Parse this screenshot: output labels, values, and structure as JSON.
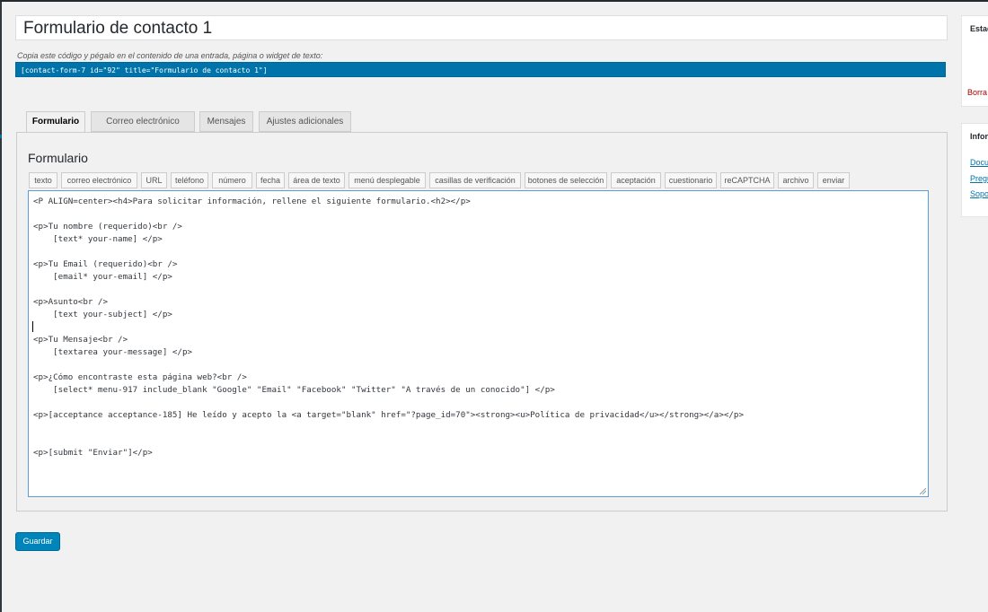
{
  "form": {
    "title": "Formulario de contacto 1",
    "shortcode_description": "Copia este código y pégalo en el contenido de una entrada, página o widget de texto:",
    "shortcode": "[contact-form-7 id=\"92\" title=\"Formulario de contacto 1\"]"
  },
  "tabs": [
    {
      "label": "Formulario",
      "active": true
    },
    {
      "label": "Correo electrónico",
      "active": false
    },
    {
      "label": "Mensajes",
      "active": false
    },
    {
      "label": "Ajustes adicionales",
      "active": false
    }
  ],
  "panel": {
    "title": "Formulario",
    "tag_buttons": [
      "texto",
      "correo electrónico",
      "URL",
      "teléfono",
      "número",
      "fecha",
      "área de texto",
      "menú desplegable",
      "casillas de verificación",
      "botones de selección",
      "aceptación",
      "cuestionario",
      "reCAPTCHA",
      "archivo",
      "enviar"
    ],
    "code_lines": [
      "<P ALIGN=center><h4>Para solicitar información, rellene el siguiente formulario.<h2></p>",
      "<p>Tu nombre (requerido)<br />",
      "    [text* your-name] </p>",
      "<p>Tu Email (requerido)<br />",
      "    [email* your-email] </p>",
      "<p>Asunto<br />",
      "    [text your-subject] </p>",
      "<p>Tu Mensaje<br />",
      "    [textarea your-message] </p>",
      "<p>¿Cómo encontraste esta página web?<br />",
      "    [select* menu-917 include_blank \"Google\" \"Email\" \"Facebook\" \"Twitter\" \"A través de un conocido\"] </p>",
      "<p>[acceptance acceptance-185] He leído y acepto la <a target=\"blank\" href=\"?page_id=70\"><strong><u>Política de privacidad</u></strong></a></p>",
      "<p>[submit \"Enviar\"]</p>"
    ]
  },
  "save_label": "Guardar",
  "sidebar": {
    "status_heading": "Estad",
    "delete_label": "Borra",
    "info_heading": "Infor",
    "links": [
      "Docu",
      "Pregu",
      "Sopo"
    ]
  },
  "colors": {
    "accent": "#0073aa",
    "button": "#0085ba",
    "delete": "#a00000",
    "editor_focus": "#5b9dd9"
  }
}
